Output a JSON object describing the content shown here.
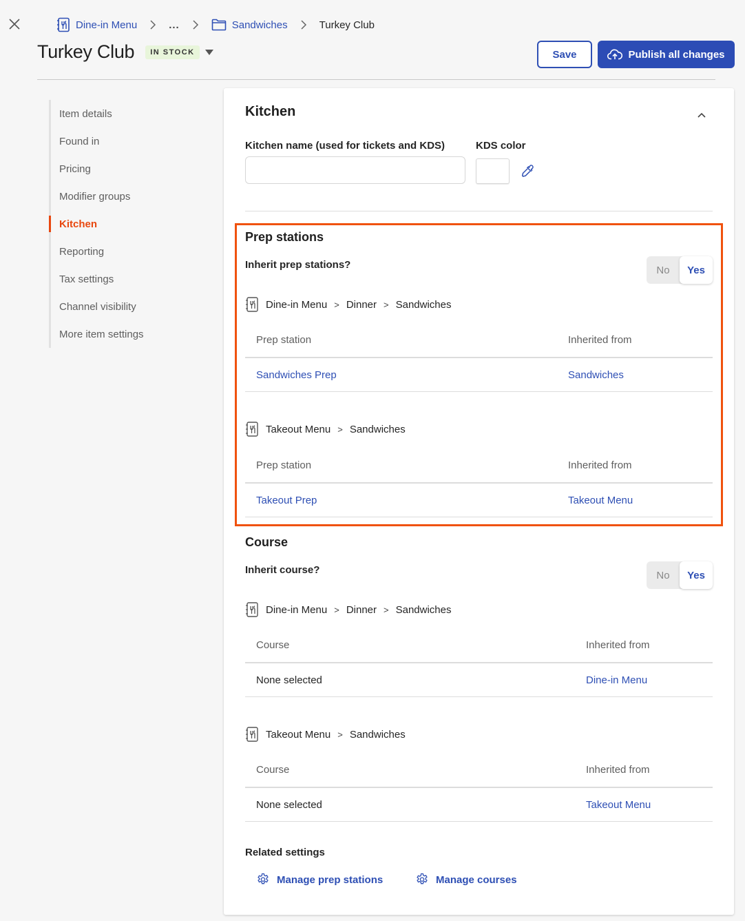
{
  "breadcrumb": {
    "items": [
      {
        "label": "Dine-in Menu",
        "icon": "menu-icon"
      },
      {
        "label": "...",
        "icon": null
      },
      {
        "label": "Sandwiches",
        "icon": "folder-icon"
      },
      {
        "label": "Turkey Club",
        "icon": null
      }
    ],
    "separator": ">"
  },
  "header": {
    "title": "Turkey Club",
    "stock_status": "IN STOCK",
    "save_label": "Save",
    "publish_label": "Publish all changes"
  },
  "sidebar": {
    "items": [
      {
        "label": "Item details",
        "active": false
      },
      {
        "label": "Found in",
        "active": false
      },
      {
        "label": "Pricing",
        "active": false
      },
      {
        "label": "Modifier groups",
        "active": false
      },
      {
        "label": "Kitchen",
        "active": true
      },
      {
        "label": "Reporting",
        "active": false
      },
      {
        "label": "Tax settings",
        "active": false
      },
      {
        "label": "Channel visibility",
        "active": false
      },
      {
        "label": "More item settings",
        "active": false
      }
    ]
  },
  "kitchen": {
    "title": "Kitchen",
    "name_label": "Kitchen name (used for tickets and KDS)",
    "name_value": "",
    "kds_color_label": "KDS color",
    "kds_color_value": "#ffffff"
  },
  "prep_stations": {
    "title": "Prep stations",
    "question": "Inherit prep stations?",
    "toggle": {
      "no": "No",
      "yes": "Yes",
      "selected": "Yes"
    },
    "groups": [
      {
        "path": [
          "Dine-in Menu",
          "Dinner",
          "Sandwiches"
        ],
        "columns": [
          "Prep station",
          "Inherited from"
        ],
        "rows": [
          {
            "value": "Sandwiches Prep",
            "inherited_from": "Sandwiches"
          }
        ]
      },
      {
        "path": [
          "Takeout Menu",
          "Sandwiches"
        ],
        "columns": [
          "Prep station",
          "Inherited from"
        ],
        "rows": [
          {
            "value": "Takeout Prep",
            "inherited_from": "Takeout Menu"
          }
        ]
      }
    ]
  },
  "course": {
    "title": "Course",
    "question": "Inherit course?",
    "toggle": {
      "no": "No",
      "yes": "Yes",
      "selected": "Yes"
    },
    "groups": [
      {
        "path": [
          "Dine-in Menu",
          "Dinner",
          "Sandwiches"
        ],
        "columns": [
          "Course",
          "Inherited from"
        ],
        "rows": [
          {
            "value": "None selected",
            "inherited_from": "Dine-in Menu"
          }
        ]
      },
      {
        "path": [
          "Takeout Menu",
          "Sandwiches"
        ],
        "columns": [
          "Course",
          "Inherited from"
        ],
        "rows": [
          {
            "value": "None selected",
            "inherited_from": "Takeout Menu"
          }
        ]
      }
    ]
  },
  "related": {
    "title": "Related settings",
    "links": [
      "Manage prep stations",
      "Manage courses"
    ]
  },
  "colors": {
    "accent_blue": "#2e4fb4",
    "active_orange": "#e8470f",
    "highlight_border": "#f0520e",
    "in_stock_bg": "#e8f5da"
  }
}
